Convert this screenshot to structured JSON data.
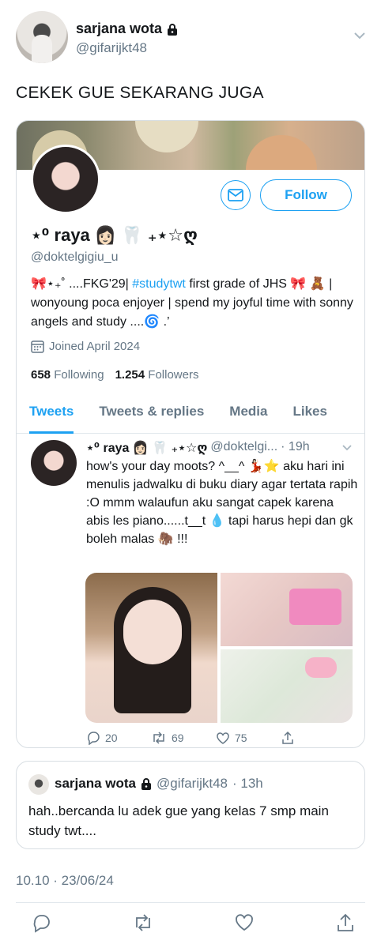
{
  "header": {
    "name": "sarjana wota",
    "handle": "@gifarijkt48",
    "avatar": "user-avatar"
  },
  "tweet_text": "CEKEK GUE SEKARANG JUGA",
  "profile_card": {
    "name": "⋆⁰ raya 👩🏻 🦷 ₊⋆☆ღ",
    "handle": "@doktelgigiu_u",
    "bio_prefix": "🎀⋆₊˚ ....FKG'29| ",
    "bio_hashtag": "#studytwt",
    "bio_suffix": " first grade of JHS 🎀 🧸 | wonyoung poca enjoyer | spend my joyful time with sonny angels and study ....🌀 .’",
    "joined": "Joined April 2024",
    "following_count": "658",
    "following_label": "Following",
    "followers_count": "1.254",
    "followers_label": "Followers",
    "follow_label": "Follow",
    "tabs": [
      "Tweets",
      "Tweets & replies",
      "Media",
      "Likes"
    ],
    "active_tab": "Tweets"
  },
  "inner_tweet": {
    "name": "⋆⁰ raya 👩🏻 🦷 ₊⋆☆ღ",
    "handle": "@doktelgi...",
    "time": "· 19h",
    "text": "how's your day moots? ^__^ 💃🏻⭐ aku hari ini menulis jadwalku di buku diary agar tertata rapih :O mmm walaufun aku sangat capek karena abis les piano......t__t 💧 tapi harus hepi dan gk boleh malas 🦣 !!!",
    "replies": "20",
    "retweets": "69",
    "likes": "75"
  },
  "reply": {
    "name": "sarjana wota",
    "handle": "@gifarijkt48",
    "time": "· 13h",
    "text": "hah..bercanda lu adek gue yang kelas 7 smp main study twt...."
  },
  "timestamp": "10.10 · 23/06/24",
  "colors": {
    "accent": "#1da1f2",
    "muted": "#657786",
    "text": "#14171a"
  }
}
